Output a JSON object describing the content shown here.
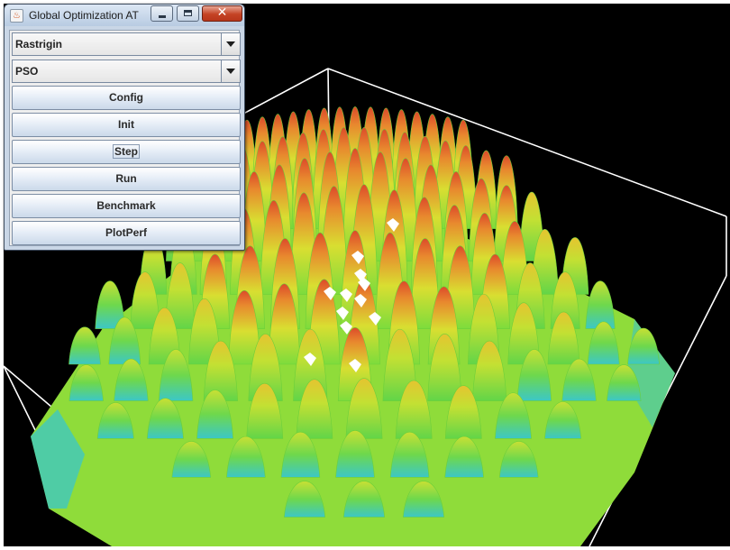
{
  "window": {
    "title": "Global Optimization AT"
  },
  "controls": {
    "function_select": {
      "value": "Rastrigin"
    },
    "algorithm_select": {
      "value": "PSO"
    },
    "buttons": [
      {
        "id": "config",
        "label": "Config"
      },
      {
        "id": "init",
        "label": "Init"
      },
      {
        "id": "step",
        "label": "Step",
        "focused": true
      },
      {
        "id": "run",
        "label": "Run"
      },
      {
        "id": "benchmark",
        "label": "Benchmark"
      },
      {
        "id": "plotperf",
        "label": "PlotPerf"
      }
    ]
  },
  "scene": {
    "background": "#000000",
    "box_color": "#ffffff",
    "surface": "Rastrigin",
    "colormap": [
      "#3fb7d8",
      "#5ad46a",
      "#a8e234",
      "#e9d12f",
      "#e8892e",
      "#e0452a"
    ],
    "particle_color": "#ffffff"
  }
}
